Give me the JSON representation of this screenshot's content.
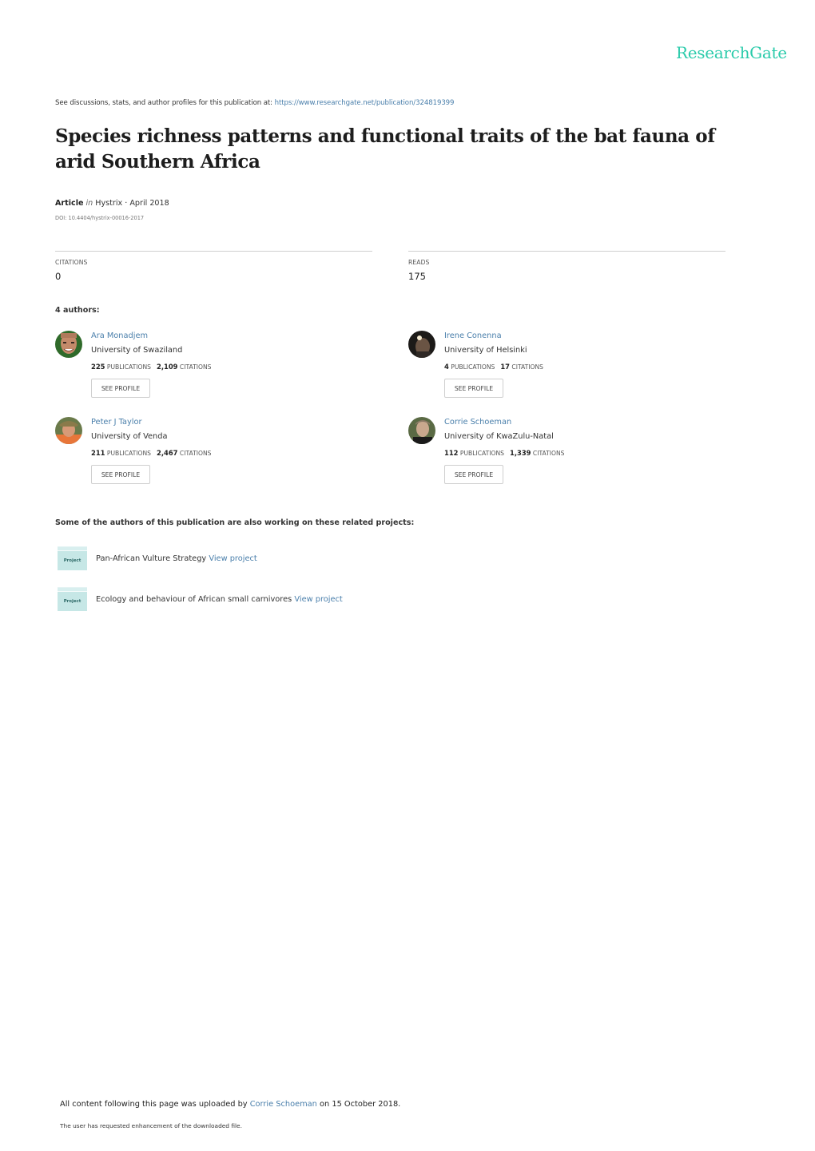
{
  "brand": {
    "name": "ResearchGate",
    "color": "#2bcbab"
  },
  "intro": {
    "text": "See discussions, stats, and author profiles for this publication at: ",
    "url_text": "https://www.researchgate.net/publication/324819399"
  },
  "publication": {
    "title": "Species richness patterns and functional traits of the bat fauna of arid Southern Africa",
    "type": "Article",
    "in_label": "in",
    "journal_date": "Hystrix · April 2018",
    "doi": "DOI: 10.4404/hystrix-00016-2017"
  },
  "stats": {
    "citations_label": "CITATIONS",
    "citations_value": "0",
    "reads_label": "READS",
    "reads_value": "175"
  },
  "authors_heading": "4 authors:",
  "authors": [
    {
      "name": "Ara Monadjem",
      "institution": "University of Swaziland",
      "publications": "225",
      "publications_label": "PUBLICATIONS",
      "citations": "2,109",
      "citations_label": "CITATIONS",
      "button": "SEE PROFILE"
    },
    {
      "name": "Irene Conenna",
      "institution": "University of Helsinki",
      "publications": "4",
      "publications_label": "PUBLICATIONS",
      "citations": "17",
      "citations_label": "CITATIONS",
      "button": "SEE PROFILE"
    },
    {
      "name": "Peter J Taylor",
      "institution": "University of Venda",
      "publications": "211",
      "publications_label": "PUBLICATIONS",
      "citations": "2,467",
      "citations_label": "CITATIONS",
      "button": "SEE PROFILE"
    },
    {
      "name": "Corrie Schoeman",
      "institution": "University of KwaZulu-Natal",
      "publications": "112",
      "publications_label": "PUBLICATIONS",
      "citations": "1,339",
      "citations_label": "CITATIONS",
      "button": "SEE PROFILE"
    }
  ],
  "projects_heading": "Some of the authors of this publication are also working on these related projects:",
  "projects": [
    {
      "icon_label": "Project",
      "name": "Pan-African Vulture Strategy",
      "link": "View project"
    },
    {
      "icon_label": "Project",
      "name": "Ecology and behaviour of African small carnivores",
      "link": "View project"
    }
  ],
  "footer": {
    "uploaded_prefix": "All content following this page was uploaded by ",
    "uploader": "Corrie Schoeman",
    "uploaded_suffix": " on 15 October 2018.",
    "requested": "The user has requested enhancement of the downloaded file."
  }
}
